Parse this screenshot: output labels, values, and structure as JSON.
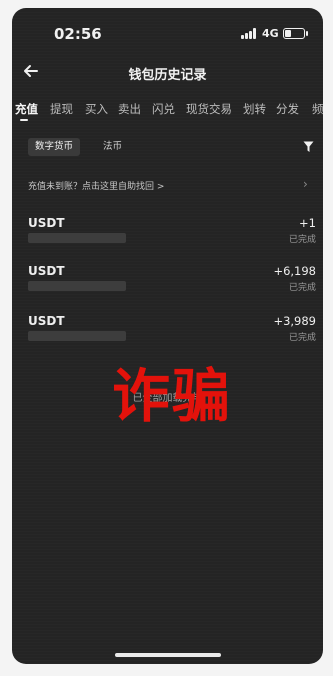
{
  "status_bar": {
    "time": "02:56",
    "network": "4G"
  },
  "header": {
    "title": "钱包历史记录"
  },
  "tabs": [
    {
      "label": "充值",
      "active": true
    },
    {
      "label": "提现",
      "active": false
    },
    {
      "label": "买入",
      "active": false
    },
    {
      "label": "卖出",
      "active": false
    },
    {
      "label": "闪兑",
      "active": false
    },
    {
      "label": "现货交易",
      "active": false
    },
    {
      "label": "划转",
      "active": false
    },
    {
      "label": "分发",
      "active": false
    },
    {
      "label": "频",
      "active": false
    }
  ],
  "filters": {
    "chips": [
      {
        "label": "数字货币",
        "active": true
      },
      {
        "label": "法币",
        "active": false
      }
    ],
    "filter_icon": "funnel-icon"
  },
  "notice": {
    "text": "充值未到账？点击这里自助找回 >"
  },
  "records": [
    {
      "coin": "USDT",
      "amount": "+1",
      "status": "已完成"
    },
    {
      "coin": "USDT",
      "amount": "+6,198",
      "status": "已完成"
    },
    {
      "coin": "USDT",
      "amount": "+3,989",
      "status": "已完成"
    }
  ],
  "footer_text": "已全部加载完毕",
  "overlay": {
    "stamp_text": "诈骗",
    "color": "#e3120b"
  },
  "colors": {
    "background": "#242424",
    "text": "#e6e6e6"
  }
}
